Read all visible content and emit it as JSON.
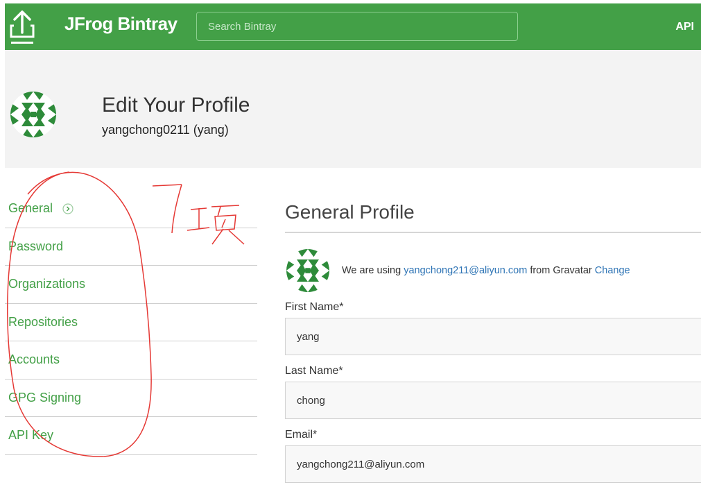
{
  "topbar": {
    "brand": "JFrog Bintray",
    "search_placeholder": "Search Bintray",
    "api_label": "API",
    "bg_color": "#43a047"
  },
  "header": {
    "title": "Edit Your Profile",
    "subtitle": "yangchong0211 (yang)"
  },
  "sidebar": {
    "items": [
      {
        "label": "General",
        "icon": "chevron-right-circle-icon"
      },
      {
        "label": "Password"
      },
      {
        "label": "Organizations"
      },
      {
        "label": "Repositories"
      },
      {
        "label": "Accounts"
      },
      {
        "label": "GPG Signing"
      },
      {
        "label": "API Key"
      }
    ]
  },
  "annotation": {
    "text": "7项"
  },
  "main": {
    "section_title": "General Profile",
    "gravatar": {
      "prefix": "We are using ",
      "email": "yangchong211@aliyun.com",
      "middle": " from Gravatar ",
      "change": "Change"
    },
    "fields": {
      "first_name": {
        "label": "First Name*",
        "value": "yang"
      },
      "last_name": {
        "label": "Last Name*",
        "value": "chong"
      },
      "email": {
        "label": "Email*",
        "value": "yangchong211@aliyun.com"
      }
    }
  }
}
